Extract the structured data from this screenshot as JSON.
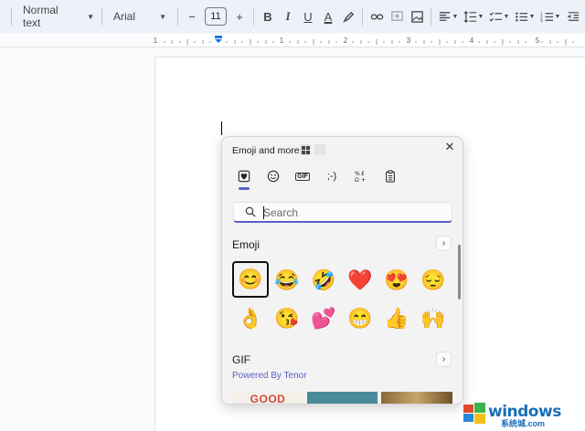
{
  "toolbar": {
    "style": "Normal text",
    "font": "Arial",
    "size_minus": "−",
    "size": "11",
    "size_plus": "+",
    "bold": "B",
    "italic": "I",
    "underline": "U",
    "text_color": "A"
  },
  "ruler": {
    "marks": [
      "1",
      "1",
      "2",
      "3",
      "4",
      "5"
    ]
  },
  "emoji_panel": {
    "title": "Emoji and more",
    "close": "✕",
    "categories": [
      {
        "name": "favorites",
        "glyph": "♥"
      },
      {
        "name": "emoji",
        "glyph": "☺"
      },
      {
        "name": "gif",
        "glyph": "GIF"
      },
      {
        "name": "kaomoji",
        "glyph": ";-)"
      },
      {
        "name": "symbols",
        "glyph": "Ω"
      },
      {
        "name": "clipboard",
        "glyph": "📋"
      }
    ],
    "search_placeholder": "Search",
    "emoji_section": {
      "title": "Emoji",
      "arrow": "›",
      "items": [
        "😊",
        "😂",
        "🤣",
        "❤️",
        "😍",
        "😔",
        "👌",
        "😘",
        "💕",
        "😁",
        "👍",
        "🙌"
      ]
    },
    "gif_section": {
      "title": "GIF",
      "arrow": "›",
      "powered_by": "Powered By Tenor",
      "thumb_text": "GOOD"
    }
  },
  "watermark": {
    "brand": "windows",
    "site": "系统城.com"
  },
  "colors": {
    "accent": "#5b5fc7",
    "toolbar_bg": "#edf2fa",
    "panel_bg": "#f3f3f3"
  }
}
